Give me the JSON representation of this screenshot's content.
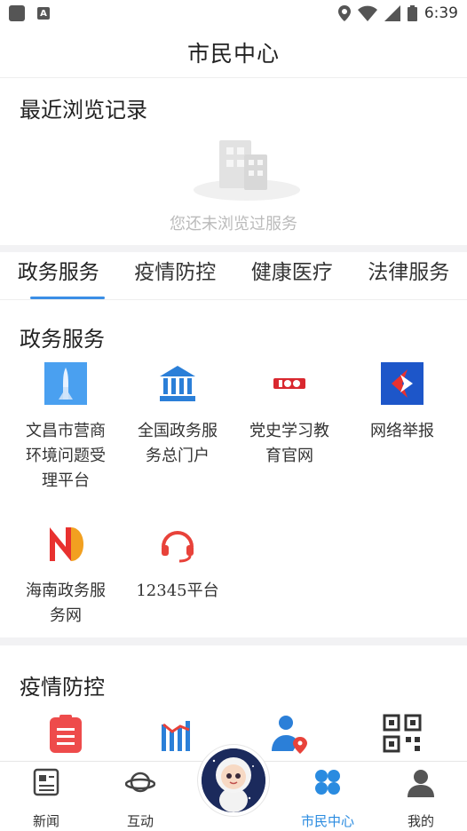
{
  "status": {
    "time": "6:39"
  },
  "header": {
    "title": "市民中心"
  },
  "recent": {
    "title": "最近浏览记录",
    "empty_text": "您还未浏览过服务"
  },
  "tabs": [
    {
      "label": "政务服务",
      "active": true
    },
    {
      "label": "疫情防控",
      "active": false
    },
    {
      "label": "健康医疗",
      "active": false
    },
    {
      "label": "法律服务",
      "active": false
    }
  ],
  "sections": [
    {
      "title": "政务服务",
      "items": [
        {
          "label": "文昌市营商环境问题受理平台",
          "icon": "rocket-icon"
        },
        {
          "label": "全国政务服务总门户",
          "icon": "government-building-icon"
        },
        {
          "label": "党史学习教育官网",
          "icon": "party-100-icon"
        },
        {
          "label": "网络举报",
          "icon": "report-arrow-icon"
        },
        {
          "label": "海南政务服务网",
          "icon": "hainan-n-icon"
        },
        {
          "label": "12345平台",
          "icon": "headset-icon"
        }
      ]
    },
    {
      "title": "疫情防控",
      "items": [
        {
          "icon": "clipboard-icon"
        },
        {
          "icon": "chart-icon"
        },
        {
          "icon": "doctor-location-icon"
        },
        {
          "icon": "qr-code-icon"
        }
      ]
    }
  ],
  "bottom_nav": [
    {
      "label": "新闻",
      "icon": "news-icon",
      "active": false
    },
    {
      "label": "互动",
      "icon": "planet-icon",
      "active": false
    },
    {
      "label": "市民中心",
      "icon": "clover-icon",
      "active": true
    },
    {
      "label": "我的",
      "icon": "user-icon",
      "active": false
    }
  ],
  "colors": {
    "accent": "#2a8be0",
    "section_gap": "#f2f2f4"
  }
}
